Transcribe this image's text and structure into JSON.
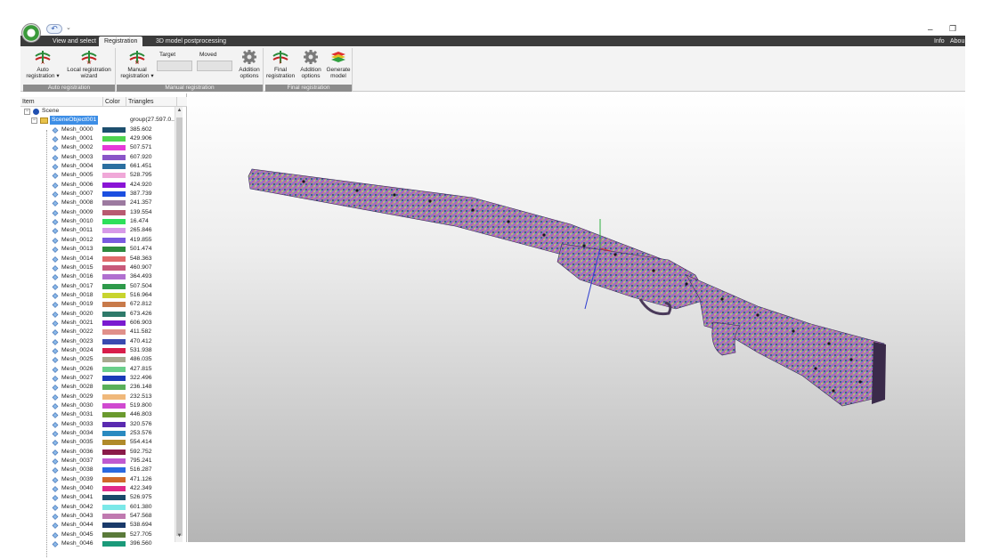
{
  "window": {
    "minimize_glyph": "–",
    "restore_glyph": "❐",
    "undo_glyph": "↶",
    "quick_access_caret": "⌄"
  },
  "tabs": [
    {
      "label": "View and select",
      "active": false
    },
    {
      "label": "Registration",
      "active": true
    },
    {
      "label": "3D model postprocessing",
      "active": false
    }
  ],
  "tabs_right": {
    "info": "Info",
    "about": "Abou"
  },
  "ribbon": {
    "groups": {
      "auto": {
        "label": "Auto registration",
        "auto_registration": "Auto registration ▾",
        "local_wizard": "Local registration wizard"
      },
      "manual": {
        "label": "Manual registration",
        "manual_registration": "Manual registration ▾",
        "target_label": "Target",
        "moved_label": "Moved",
        "addition_options": "Addition options"
      },
      "final": {
        "label": "Final registration",
        "final_registration": "Final registration",
        "addition_options": "Addition options",
        "generate_model": "Generate model"
      }
    }
  },
  "tree_panel": {
    "columns": {
      "item": "Item",
      "color": "Color",
      "triangles": "Triangles"
    },
    "root": {
      "label": "Scene"
    },
    "group": {
      "label": "SceneObject001",
      "triangles": "group(27.597.0..."
    },
    "meshes": [
      {
        "name": "Mesh_0000",
        "color": "#1d4f6e",
        "triangles": "385.602"
      },
      {
        "name": "Mesh_0001",
        "color": "#4fd44f",
        "triangles": "429.906"
      },
      {
        "name": "Mesh_0002",
        "color": "#e63ad8",
        "triangles": "507.571"
      },
      {
        "name": "Mesh_0003",
        "color": "#8a55c8",
        "triangles": "607.920"
      },
      {
        "name": "Mesh_0004",
        "color": "#2b6fa0",
        "triangles": "661.451"
      },
      {
        "name": "Mesh_0005",
        "color": "#f0a8d8",
        "triangles": "528.795"
      },
      {
        "name": "Mesh_0006",
        "color": "#8a14d6",
        "triangles": "424.920"
      },
      {
        "name": "Mesh_0007",
        "color": "#1c4fe0",
        "triangles": "387.739"
      },
      {
        "name": "Mesh_0008",
        "color": "#9c7aa0",
        "triangles": "241.357"
      },
      {
        "name": "Mesh_0009",
        "color": "#b85a70",
        "triangles": "139.554"
      },
      {
        "name": "Mesh_0010",
        "color": "#2ee05a",
        "triangles": "16.474"
      },
      {
        "name": "Mesh_0011",
        "color": "#d79ae8",
        "triangles": "265.846"
      },
      {
        "name": "Mesh_0012",
        "color": "#7a5ae0",
        "triangles": "419.855"
      },
      {
        "name": "Mesh_0013",
        "color": "#2e8a3e",
        "triangles": "501.474"
      },
      {
        "name": "Mesh_0014",
        "color": "#e06a6a",
        "triangles": "548.363"
      },
      {
        "name": "Mesh_0015",
        "color": "#c85a7a",
        "triangles": "460.907"
      },
      {
        "name": "Mesh_0016",
        "color": "#b070d0",
        "triangles": "364.493"
      },
      {
        "name": "Mesh_0017",
        "color": "#2e9a4a",
        "triangles": "507.504"
      },
      {
        "name": "Mesh_0018",
        "color": "#c8d42e",
        "triangles": "516.964"
      },
      {
        "name": "Mesh_0019",
        "color": "#c87a4a",
        "triangles": "672.812"
      },
      {
        "name": "Mesh_0020",
        "color": "#2e7a6a",
        "triangles": "673.426"
      },
      {
        "name": "Mesh_0021",
        "color": "#7a1ad0",
        "triangles": "606.903"
      },
      {
        "name": "Mesh_0022",
        "color": "#e0908a",
        "triangles": "411.582"
      },
      {
        "name": "Mesh_0023",
        "color": "#3a4ab0",
        "triangles": "470.412"
      },
      {
        "name": "Mesh_0024",
        "color": "#d81e4a",
        "triangles": "531.938"
      },
      {
        "name": "Mesh_0025",
        "color": "#a8a890",
        "triangles": "486.035"
      },
      {
        "name": "Mesh_0026",
        "color": "#6acf8a",
        "triangles": "427.815"
      },
      {
        "name": "Mesh_0027",
        "color": "#1a3ab8",
        "triangles": "322.496"
      },
      {
        "name": "Mesh_0028",
        "color": "#5ab05a",
        "triangles": "236.148"
      },
      {
        "name": "Mesh_0029",
        "color": "#f0b87a",
        "triangles": "232.513"
      },
      {
        "name": "Mesh_0030",
        "color": "#d04ad0",
        "triangles": "519.800"
      },
      {
        "name": "Mesh_0031",
        "color": "#6a9a2e",
        "triangles": "446.803"
      },
      {
        "name": "Mesh_0033",
        "color": "#5a2ab0",
        "triangles": "320.576"
      },
      {
        "name": "Mesh_0034",
        "color": "#2a8ac0",
        "triangles": "253.576"
      },
      {
        "name": "Mesh_0035",
        "color": "#b08a2a",
        "triangles": "554.414"
      },
      {
        "name": "Mesh_0036",
        "color": "#8a1a4a",
        "triangles": "592.752"
      },
      {
        "name": "Mesh_0037",
        "color": "#c05ad0",
        "triangles": "795.241"
      },
      {
        "name": "Mesh_0038",
        "color": "#2a6ae0",
        "triangles": "516.287"
      },
      {
        "name": "Mesh_0039",
        "color": "#d06a2a",
        "triangles": "471.126"
      },
      {
        "name": "Mesh_0040",
        "color": "#e02a8a",
        "triangles": "422.349"
      },
      {
        "name": "Mesh_0041",
        "color": "#1a4a6a",
        "triangles": "526.975"
      },
      {
        "name": "Mesh_0042",
        "color": "#7ae8e8",
        "triangles": "601.380"
      },
      {
        "name": "Mesh_0043",
        "color": "#c07ab0",
        "triangles": "547.568"
      },
      {
        "name": "Mesh_0044",
        "color": "#1a3a6a",
        "triangles": "538.694"
      },
      {
        "name": "Mesh_0045",
        "color": "#5a7a3a",
        "triangles": "527.705"
      },
      {
        "name": "Mesh_0046",
        "color": "#1a9a7a",
        "triangles": "396.560"
      }
    ]
  },
  "viewport": {
    "model": "shotgun point-cloud mesh",
    "gizmo_colors": {
      "x": "#d03030",
      "y": "#30b040",
      "z": "#3040d0"
    }
  },
  "colors": {
    "tabbar": "#3b3b3b",
    "group_label_bar": "#8c8c8c",
    "selection": "#3d8ee6"
  }
}
